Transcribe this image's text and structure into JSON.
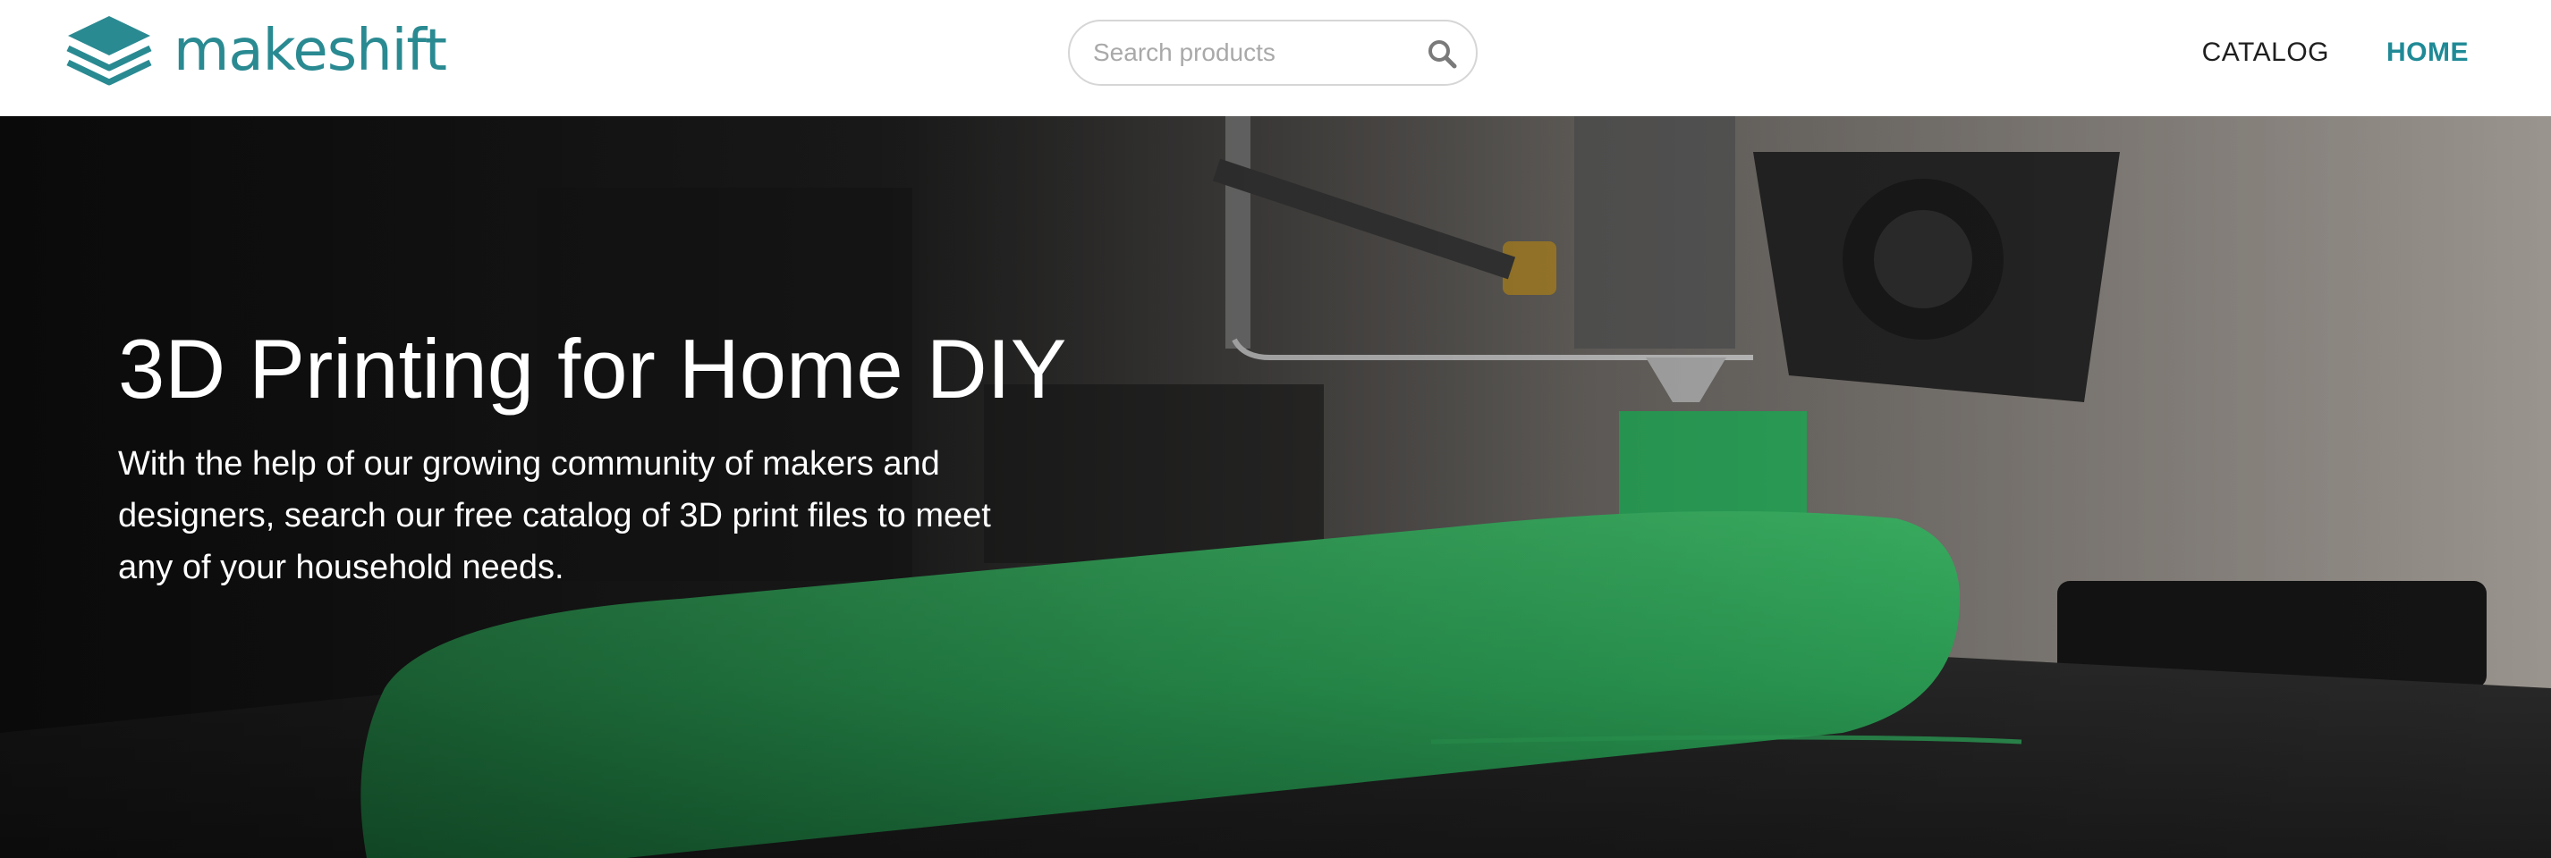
{
  "brand": {
    "name": "makeshift",
    "accent_color": "#2a8a92",
    "logo_icon": "stacked-layers-icon"
  },
  "search": {
    "placeholder": "Search products",
    "value": "",
    "icon": "search-icon"
  },
  "nav": {
    "items": [
      {
        "label": "CATALOG",
        "active": false
      },
      {
        "label": "HOME",
        "active": true
      }
    ],
    "active_color": "#1f8a96"
  },
  "hero": {
    "title": "3D Printing for Home DIY",
    "text": "With the help of our growing community of makers and designers, search our free catalog of 3D print files to meet any of your household needs."
  }
}
